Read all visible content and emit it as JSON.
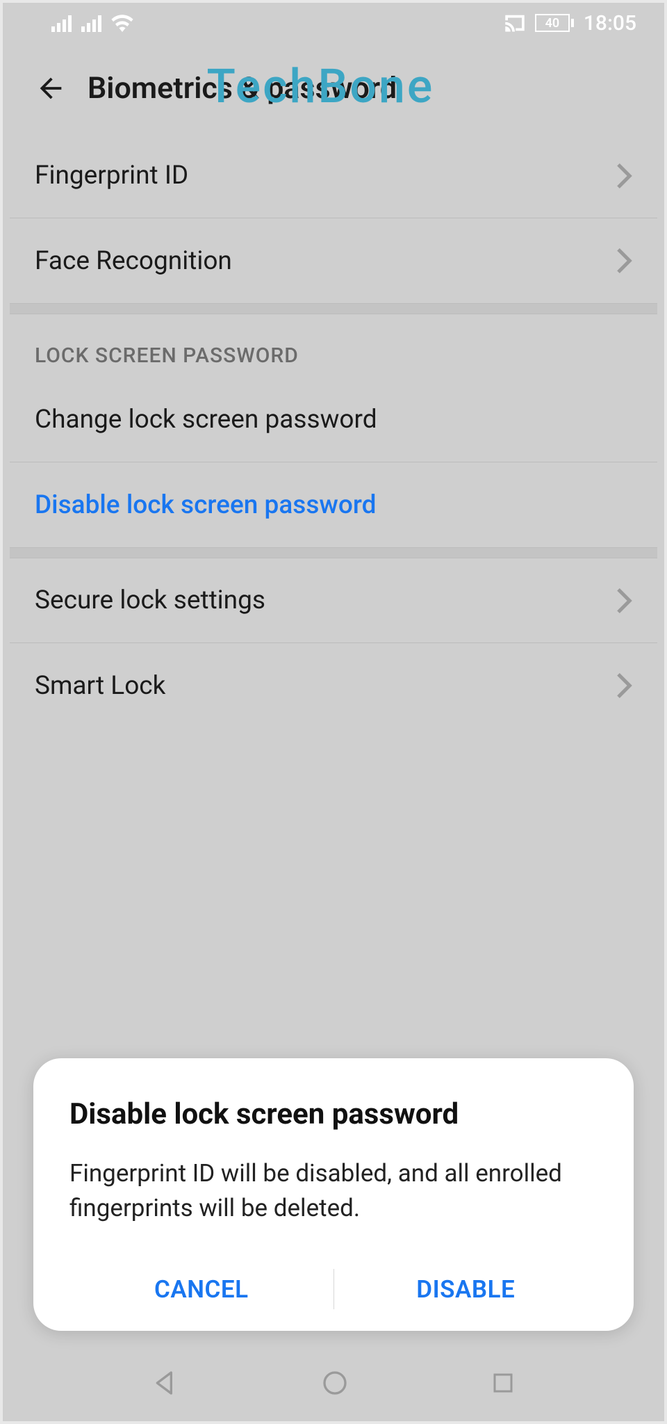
{
  "status": {
    "battery_text": "40",
    "time": "18:05"
  },
  "header": {
    "title": "Biometrics & password"
  },
  "watermark": "TechBone",
  "sections": {
    "bio": {
      "fingerprint": "Fingerprint ID",
      "face": "Face Recognition"
    },
    "lock": {
      "header": "LOCK SCREEN PASSWORD",
      "change": "Change lock screen password",
      "disable": "Disable lock screen password"
    },
    "settings": {
      "secure": "Secure lock settings",
      "smart": "Smart Lock"
    }
  },
  "dialog": {
    "title": "Disable lock screen password",
    "body": "Fingerprint ID will be disabled, and all enrolled fingerprints will be deleted.",
    "cancel": "CANCEL",
    "confirm": "DISABLE"
  },
  "colors": {
    "accent": "#1976f0",
    "watermark": "#3da6c4"
  }
}
